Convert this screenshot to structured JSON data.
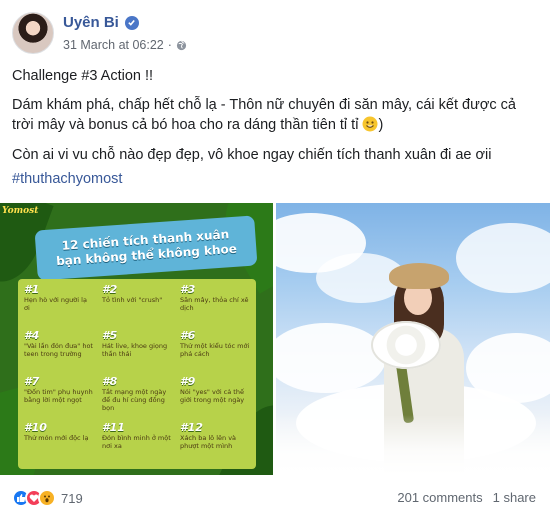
{
  "post": {
    "author": "Uyên Bi",
    "timestamp": "31 March at 06:22",
    "separator": "·",
    "paragraph_1": "Challenge #3 Action !!",
    "paragraph_2": "Dám khám phá, chấp hết chỗ lạ - Thôn nữ chuyên đi săn mây, cái kết được cả trời mây và bonus cả bó hoa cho ra dáng thần tiên tỉ tỉ",
    "paragraph_2_end": ")",
    "paragraph_3": "Còn ai vi vu chỗ nào đẹp đẹp, vô khoe ngay chiến tích thanh xuân đi ae ơii",
    "hashtag": "#thuthachyomost"
  },
  "infographic": {
    "logo": "Yomost",
    "title_line_1": "12 chiến tích thanh xuân",
    "title_line_2": "bạn không thể không khoe",
    "items": [
      {
        "num": "#1",
        "text": "Hẹn hò với người lạ ơi"
      },
      {
        "num": "#2",
        "text": "Tỏ tình với \"crush\""
      },
      {
        "num": "#3",
        "text": "Săn mây, thỏa chí xê dịch"
      },
      {
        "num": "#4",
        "text": "\"Vài lần đón đưa\" hot teen trong trường"
      },
      {
        "num": "#5",
        "text": "Hát live, khoe giọng thần thái"
      },
      {
        "num": "#6",
        "text": "Thử một kiểu tóc mới phá cách"
      },
      {
        "num": "#7",
        "text": "\"Đốn tim\" phụ huynh bằng lời một ngọt"
      },
      {
        "num": "#8",
        "text": "Tắt mạng một ngày để đu hí cùng đồng bọn"
      },
      {
        "num": "#9",
        "text": "Nói \"yes\" với cả thế giới trong một ngày"
      },
      {
        "num": "#10",
        "text": "Thử món mới độc lạ"
      },
      {
        "num": "#11",
        "text": "Đón bình minh ở một nơi xa"
      },
      {
        "num": "#12",
        "text": "Xách ba lô lên và phượt một mình"
      }
    ]
  },
  "footer": {
    "reaction_icons": [
      "like-icon",
      "love-icon",
      "wow-icon"
    ],
    "reaction_count": "719",
    "comments": "201 comments",
    "shares": "1 share"
  },
  "colors": {
    "link": "#385898",
    "like": "#1877f2",
    "love": "#f33e58",
    "wow": "#f7b125"
  }
}
